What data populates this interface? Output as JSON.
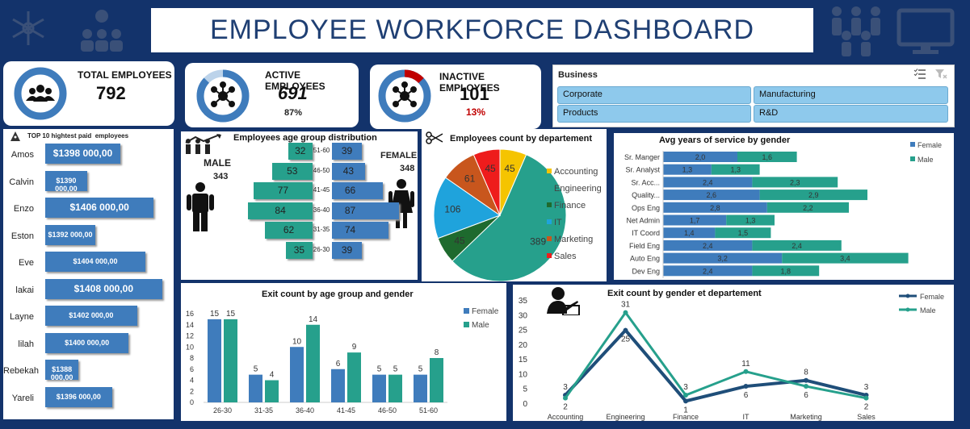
{
  "header": {
    "title": "EMPLOYEE WORKFORCE DASHBOARD"
  },
  "kpis": {
    "total": {
      "label": "TOTAL EMPLOYEES",
      "value": "792"
    },
    "active": {
      "label": "ACTIVE EMPLOYEES",
      "value": "691",
      "pct": "87%",
      "fill": 0.87
    },
    "inactive": {
      "label": "INACTIVE EMPLOYEES",
      "value": "101",
      "pct": "13%",
      "fill": 0.13
    }
  },
  "slicer": {
    "title": "Business",
    "options": [
      "Corporate",
      "Manufacturing",
      "Products",
      "R&D"
    ]
  },
  "top10": {
    "title": "TOP 10 hightest paid  employees",
    "names": [
      "Amos",
      "Calvin",
      "Enzo",
      "Eston",
      "Eve",
      "lakai",
      "Layne",
      "lilah",
      "Rebekah",
      "Yareli"
    ],
    "labels": [
      "$1398 000,00",
      "$1390 000,00",
      "$1406 000,00",
      "$1392 000,00",
      "$1404 000,00",
      "$1408 000,00",
      "$1402 000,00",
      "$1400 000,00",
      "$1388 000,00",
      "$1396 000,00"
    ],
    "values": [
      1398000,
      1390000,
      1406000,
      1392000,
      1404000,
      1408000,
      1402000,
      1400000,
      1388000,
      1396000
    ]
  },
  "age_dist": {
    "title": "Employees age group distribution",
    "male_label": "MALE",
    "male_total": "343",
    "female_label": "FEMALE",
    "female_total": "348",
    "groups": [
      "51-60",
      "46-50",
      "41-45",
      "36-40",
      "31-35",
      "26-30"
    ],
    "male": [
      32,
      53,
      77,
      84,
      62,
      35
    ],
    "female": [
      39,
      43,
      66,
      87,
      74,
      39
    ]
  },
  "chart_data": [
    {
      "type": "pie",
      "title": "Employees count by departement",
      "categories": [
        "Accounting",
        "Engineering",
        "Finance",
        "IT",
        "Marketing",
        "Sales"
      ],
      "values": [
        45,
        389,
        45,
        106,
        61,
        45
      ],
      "colors": [
        "#f5c400",
        "#26a08c",
        "#1e6a2e",
        "#1fa3dc",
        "#c8561d",
        "#ee1c1c"
      ]
    },
    {
      "type": "bar",
      "title": "Avg years of service by gender",
      "categories": [
        "Sr. Manger",
        "Sr. Analyst",
        "Sr. Acc...",
        "Quality...",
        "Ops Eng",
        "Net Admin",
        "IT Coord",
        "Field Eng",
        "Auto Eng",
        "Dev Eng"
      ],
      "series": [
        {
          "name": "Female",
          "values": [
            2.0,
            1.3,
            2.4,
            2.6,
            2.8,
            1.7,
            1.4,
            2.4,
            3.2,
            2.4
          ],
          "labels": [
            "2,0",
            "1,3",
            "2,4",
            "2,6",
            "2,8",
            "1,7",
            "1,4",
            "2,4",
            "3,2",
            "2,4"
          ]
        },
        {
          "name": "Male",
          "values": [
            1.6,
            1.3,
            2.3,
            2.9,
            2.2,
            1.3,
            1.5,
            2.4,
            3.4,
            1.8
          ],
          "labels": [
            "1,6",
            "1,3",
            "2,3",
            "2,9",
            "2,2",
            "1,3",
            "1,5",
            "2,4",
            "3,4",
            "1,8"
          ]
        }
      ]
    },
    {
      "type": "bar",
      "title": "Exit count by age group and gender",
      "categories": [
        "26-30",
        "31-35",
        "36-40",
        "41-45",
        "46-50",
        "51-60"
      ],
      "series": [
        {
          "name": "Female",
          "values": [
            15,
            5,
            10,
            6,
            5,
            5
          ]
        },
        {
          "name": "Male",
          "values": [
            15,
            4,
            14,
            9,
            5,
            8
          ]
        }
      ],
      "ylim": [
        0,
        16
      ],
      "yticks": [
        0,
        2,
        4,
        6,
        8,
        10,
        12,
        14,
        16
      ]
    },
    {
      "type": "line",
      "title": "Exit count by gender et departement",
      "categories": [
        "Accounting",
        "Engineering",
        "Finance",
        "IT",
        "Marketing",
        "Sales"
      ],
      "series": [
        {
          "name": "Female",
          "values": [
            3,
            25,
            1,
            6,
            8,
            3
          ]
        },
        {
          "name": "Male",
          "values": [
            2,
            31,
            3,
            11,
            6,
            2
          ]
        }
      ],
      "ylim": [
        0,
        35
      ],
      "yticks": [
        0,
        5,
        10,
        15,
        20,
        25,
        30,
        35
      ]
    }
  ],
  "colors": {
    "navy": "#13336b",
    "blue": "#3f7cbc",
    "teal": "#26a08c",
    "red": "#c00000"
  }
}
